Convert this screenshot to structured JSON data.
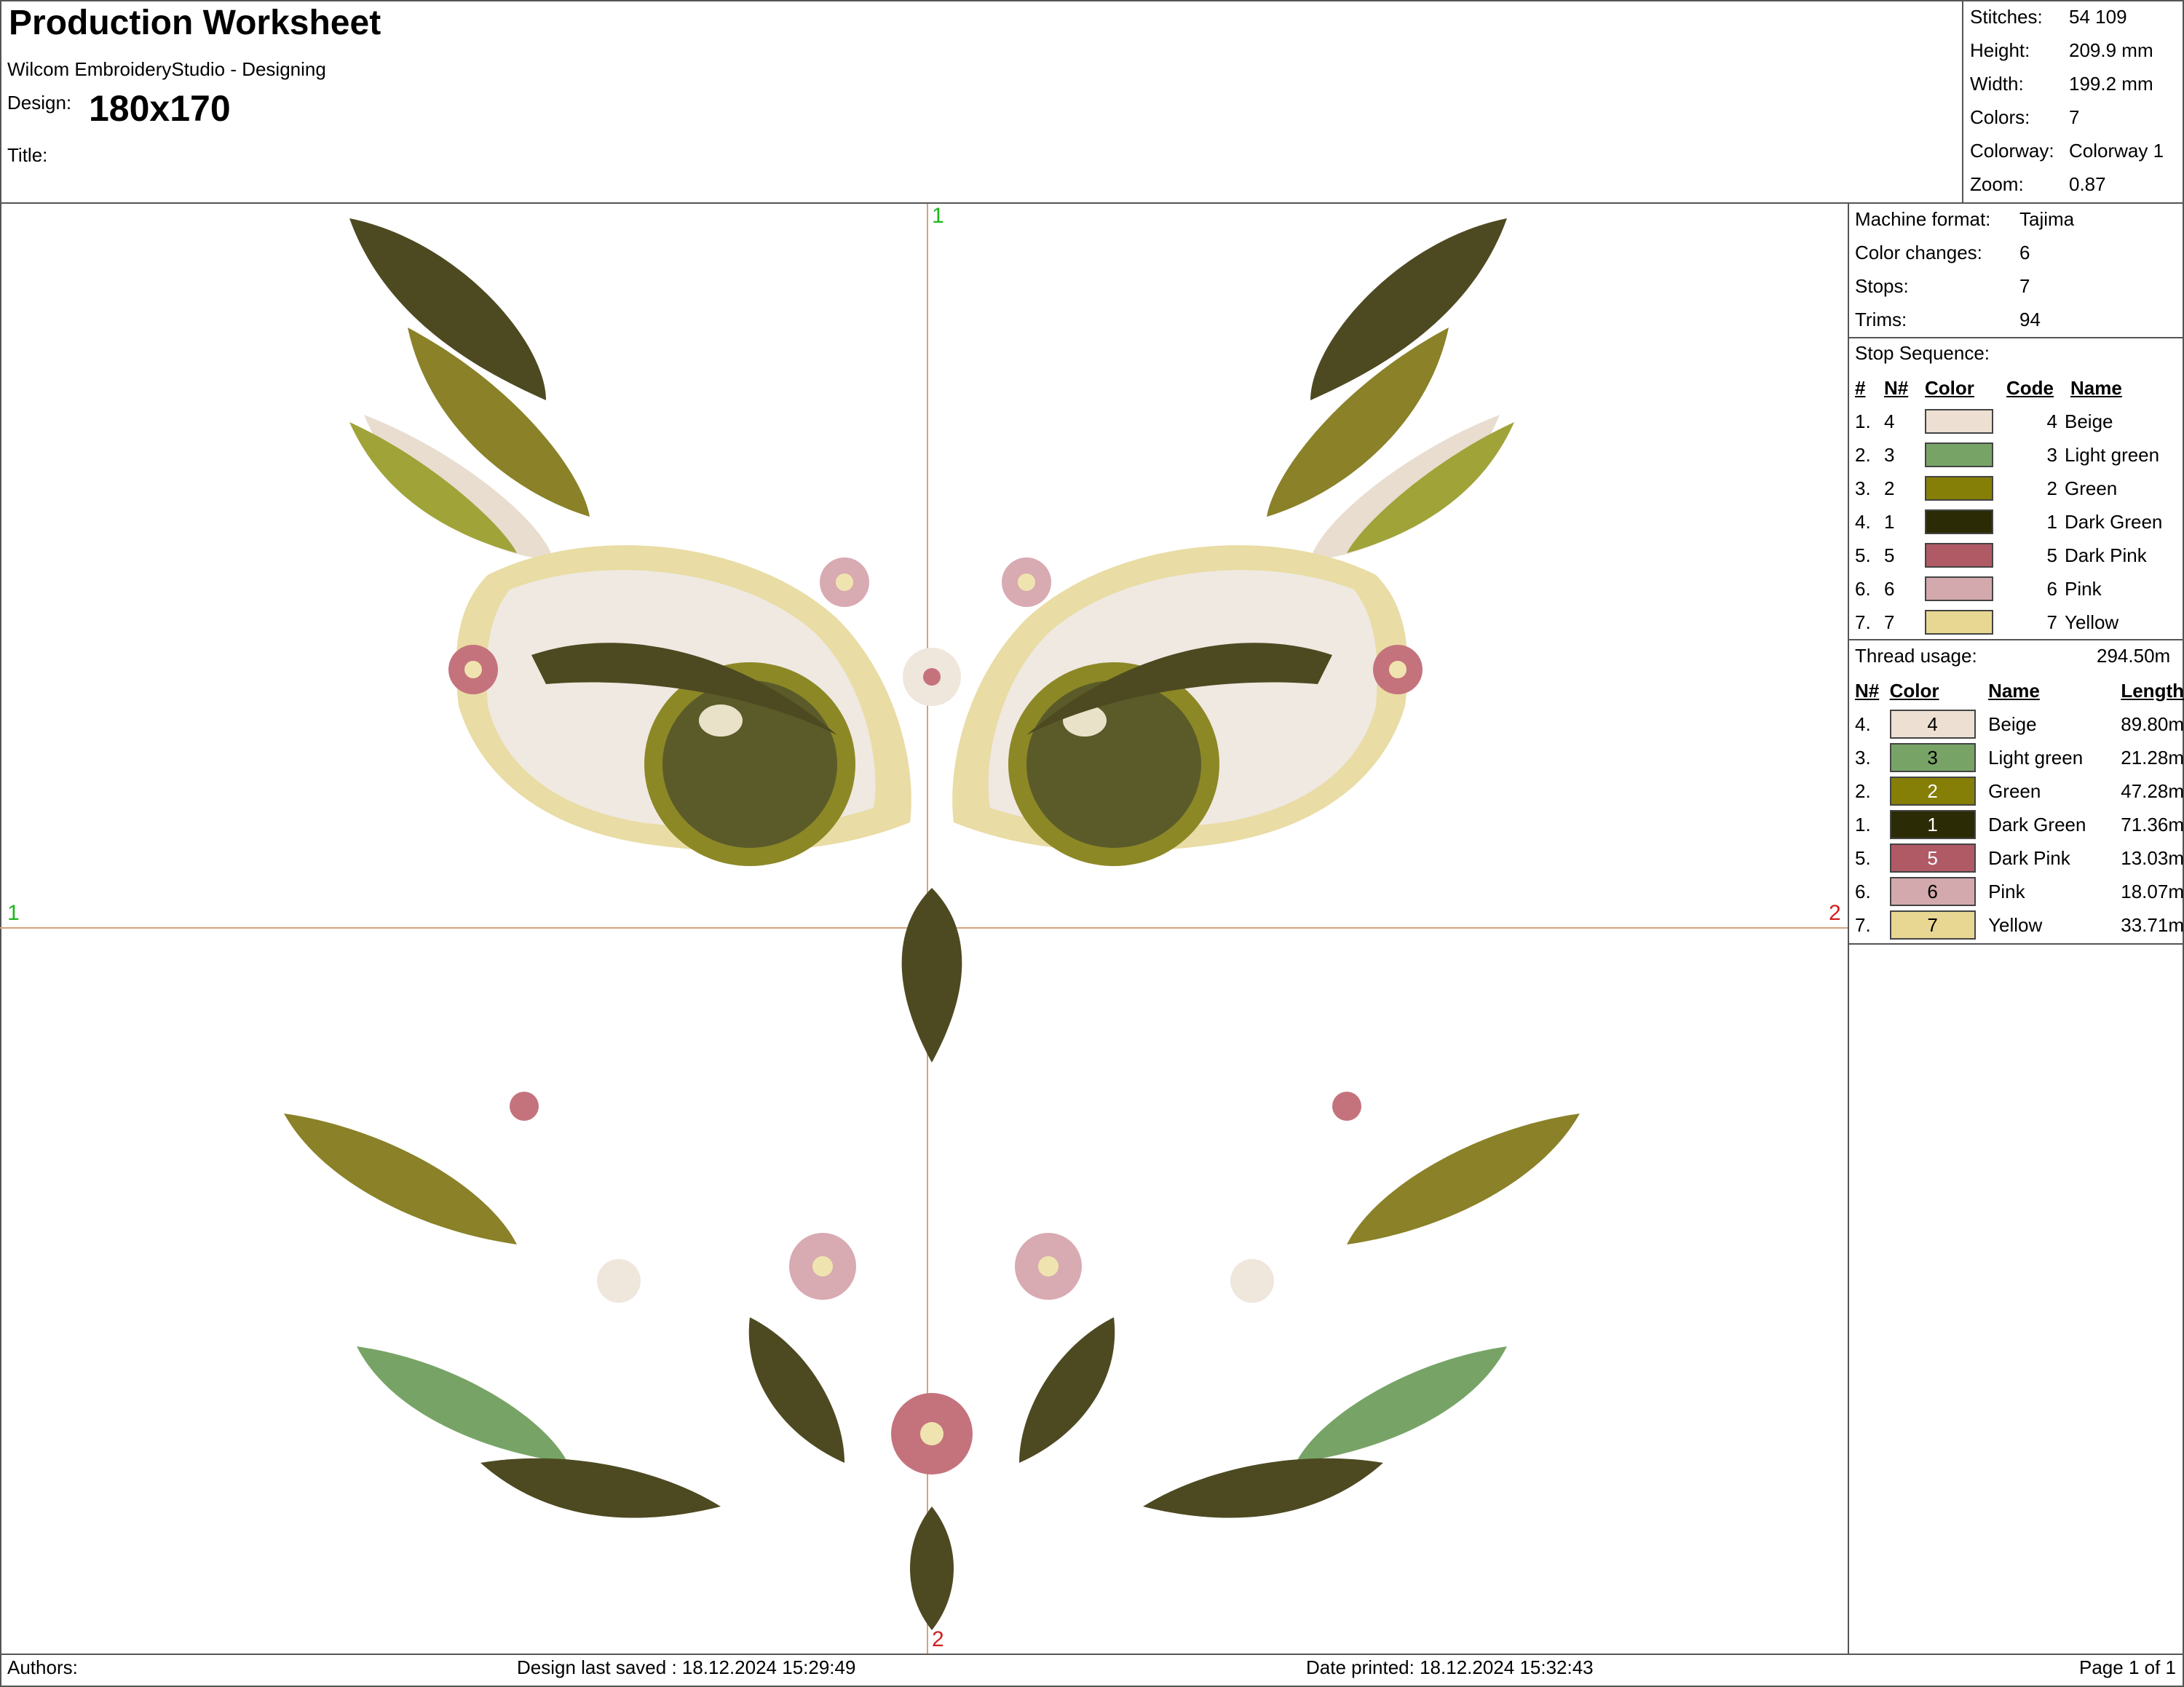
{
  "header": {
    "title": "Production Worksheet",
    "software": "Wilcom EmbroideryStudio - Designing",
    "design_label": "Design:",
    "design_value": "180x170",
    "title_label": "Title:"
  },
  "summary": [
    {
      "label": "Stitches:",
      "value": "54 109"
    },
    {
      "label": "Height:",
      "value": "209.9 mm"
    },
    {
      "label": "Width:",
      "value": "199.2 mm"
    },
    {
      "label": "Colors:",
      "value": "7"
    },
    {
      "label": "Colorway:",
      "value": "Colorway 1"
    },
    {
      "label": "Zoom:",
      "value": "0.87"
    }
  ],
  "machine": [
    {
      "label": "Machine format:",
      "value": "Tajima"
    },
    {
      "label": "Color changes:",
      "value": "6"
    },
    {
      "label": "Stops:",
      "value": "7"
    },
    {
      "label": "Trims:",
      "value": "94"
    }
  ],
  "stop_sequence": {
    "title": "Stop Sequence:",
    "headers": [
      "#",
      "N#",
      "Color",
      "Code",
      "Name"
    ],
    "rows": [
      {
        "idx": "1.",
        "n": "4",
        "color": "#ede0d2",
        "code": "4",
        "name": "Beige"
      },
      {
        "idx": "2.",
        "n": "3",
        "color": "#77a466",
        "code": "3",
        "name": "Light green"
      },
      {
        "idx": "3.",
        "n": "2",
        "color": "#857e07",
        "code": "2",
        "name": "Green"
      },
      {
        "idx": "4.",
        "n": "1",
        "color": "#2b2b05",
        "code": "1",
        "name": "Dark Green"
      },
      {
        "idx": "5.",
        "n": "5",
        "color": "#b05a66",
        "code": "5",
        "name": "Dark Pink"
      },
      {
        "idx": "6.",
        "n": "6",
        "color": "#d3a9ad",
        "code": "6",
        "name": "Pink"
      },
      {
        "idx": "7.",
        "n": "7",
        "color": "#e8d793",
        "code": "7",
        "name": "Yellow"
      }
    ]
  },
  "thread_usage": {
    "title": "Thread usage:",
    "total": "294.50m",
    "headers": [
      "N#",
      "Color",
      "Name",
      "Length"
    ],
    "rows": [
      {
        "n": "4.",
        "color": "#ede0d2",
        "code": "4",
        "text_color": "#000",
        "name": "Beige",
        "length": "89.80m"
      },
      {
        "n": "3.",
        "color": "#77a466",
        "code": "3",
        "text_color": "#000",
        "name": "Light green",
        "length": "21.28m"
      },
      {
        "n": "2.",
        "color": "#857e07",
        "code": "2",
        "text_color": "#fff",
        "name": "Green",
        "length": "47.28m"
      },
      {
        "n": "1.",
        "color": "#2b2b05",
        "code": "1",
        "text_color": "#fff",
        "name": "Dark Green",
        "length": "71.36m"
      },
      {
        "n": "5.",
        "color": "#b05a66",
        "code": "5",
        "text_color": "#fff",
        "name": "Dark Pink",
        "length": "13.03m"
      },
      {
        "n": "6.",
        "color": "#d3a9ad",
        "code": "6",
        "text_color": "#000",
        "name": "Pink",
        "length": "18.07m"
      },
      {
        "n": "7.",
        "color": "#e8d793",
        "code": "7",
        "text_color": "#000",
        "name": "Yellow",
        "length": "33.71m"
      }
    ]
  },
  "axes": {
    "left": "1",
    "right": "2",
    "top": "1",
    "bottom": "2"
  },
  "footer": {
    "authors": "Authors:",
    "saved": "Design last saved : 18.12.2024 15:29:49",
    "printed": "Date printed: 18.12.2024 15:32:43",
    "page": "Page 1 of 1"
  },
  "design_image": {
    "subject": "owl-embroidery-design"
  }
}
